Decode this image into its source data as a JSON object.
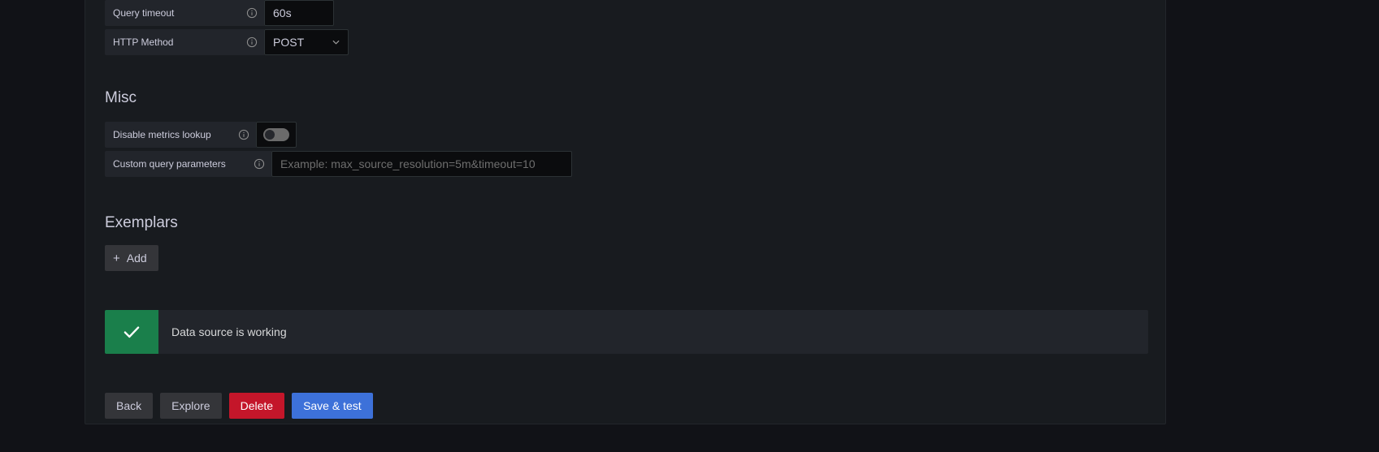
{
  "settings": {
    "query_timeout": {
      "label": "Query timeout",
      "value": "60s",
      "info_icon": "info-circle-icon"
    },
    "http_method": {
      "label": "HTTP Method",
      "value": "POST",
      "info_icon": "info-circle-icon",
      "caret_icon": "chevron-down-icon"
    }
  },
  "misc": {
    "heading": "Misc",
    "disable_metrics_lookup": {
      "label": "Disable metrics lookup",
      "info_icon": "info-circle-icon",
      "state": "off"
    },
    "custom_query_parameters": {
      "label": "Custom query parameters",
      "info_icon": "info-circle-icon",
      "value": "",
      "placeholder": "Example: max_source_resolution=5m&timeout=10"
    }
  },
  "exemplars": {
    "heading": "Exemplars",
    "add_button": {
      "label": "Add",
      "icon": "plus-icon"
    }
  },
  "alert": {
    "message": "Data source is working",
    "icon": "check-icon",
    "color": "#1a7f4b"
  },
  "actions": {
    "back": "Back",
    "explore": "Explore",
    "delete": "Delete",
    "save_and_test": "Save & test"
  },
  "colors": {
    "page_background": "#111217",
    "panel_background": "#181b1f",
    "field_label_background": "#22252b",
    "input_background": "#0b0c0e",
    "success": "#1a7f4b",
    "danger": "#c4162a",
    "primary": "#3d71d9",
    "text": "#ccccdc"
  }
}
